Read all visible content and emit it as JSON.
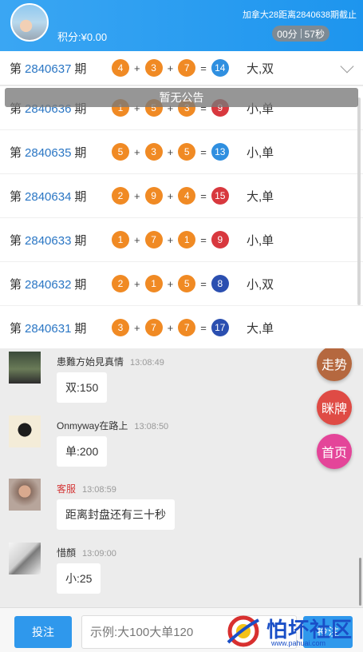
{
  "header": {
    "score_label": "积分:¥0.00",
    "countdown_title": "加拿大28距离2840638期截止",
    "timer_min": "00分",
    "timer_sec": "57秒"
  },
  "current_draw": {
    "prefix": "第",
    "period": "2840637",
    "suffix": "期",
    "balls": [
      "4",
      "3",
      "7"
    ],
    "sum": "14",
    "result": "大,双"
  },
  "notice": "暂无公告",
  "history": [
    {
      "prefix": "第",
      "period": "2840636",
      "suffix": "期",
      "balls": [
        "1",
        "5",
        "3"
      ],
      "sum": "9",
      "sum_color": "red",
      "result": "小,单"
    },
    {
      "prefix": "第",
      "period": "2840635",
      "suffix": "期",
      "balls": [
        "5",
        "3",
        "5"
      ],
      "sum": "13",
      "sum_color": "blue",
      "result": "小,单"
    },
    {
      "prefix": "第",
      "period": "2840634",
      "suffix": "期",
      "balls": [
        "2",
        "9",
        "4"
      ],
      "sum": "15",
      "sum_color": "red",
      "result": "大,单"
    },
    {
      "prefix": "第",
      "period": "2840633",
      "suffix": "期",
      "balls": [
        "1",
        "7",
        "1"
      ],
      "sum": "9",
      "sum_color": "red",
      "result": "小,单"
    },
    {
      "prefix": "第",
      "period": "2840632",
      "suffix": "期",
      "balls": [
        "2",
        "1",
        "5"
      ],
      "sum": "8",
      "sum_color": "navy",
      "result": "小,双"
    },
    {
      "prefix": "第",
      "period": "2840631",
      "suffix": "期",
      "balls": [
        "3",
        "7",
        "7"
      ],
      "sum": "17",
      "sum_color": "navy",
      "result": "大,单"
    }
  ],
  "operators": {
    "plus": "+",
    "equals": "="
  },
  "chat": [
    {
      "name": "患難方始見真情",
      "time": "13:08:49",
      "text": "双:150",
      "name_color": "normal"
    },
    {
      "name": "Onmyway在路上",
      "time": "13:08:50",
      "text": "单:200",
      "name_color": "normal"
    },
    {
      "name": "客服",
      "time": "13:08:59",
      "text": "距离封盘还有三十秒",
      "name_color": "red"
    },
    {
      "name": "惜顏",
      "time": "13:09:00",
      "text": "小:25",
      "name_color": "normal"
    }
  ],
  "floating": {
    "trend": "走势",
    "squeeze": "眯牌",
    "home": "首页"
  },
  "bottom": {
    "bet_label": "投注",
    "input_placeholder": "示例:大100大单120",
    "send_label": "投注"
  },
  "watermark": {
    "text": "怕坏社区",
    "url": "www.pahuai.com"
  }
}
